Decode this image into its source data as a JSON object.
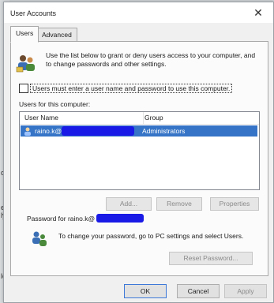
{
  "background": {
    "left_fragments": [
      "o",
      "e",
      "ly",
      "lc"
    ]
  },
  "window": {
    "title": "User Accounts",
    "close_glyph": "✕"
  },
  "tabs": [
    {
      "label": "Users",
      "active": true
    },
    {
      "label": "Advanced",
      "active": false
    }
  ],
  "users_tab": {
    "intro_text": "Use the list below to grant or deny users access to your computer, and to change passwords and other settings.",
    "require_login_checkbox": {
      "label": "Users must enter a user name and password to use this computer.",
      "checked": false
    },
    "users_list_title": "Users for this computer:",
    "columns": [
      "User Name",
      "Group"
    ],
    "rows": [
      {
        "user_name": "raino.k@",
        "group": "Administrators",
        "selected": true
      }
    ],
    "buttons": {
      "add": "Add...",
      "remove": "Remove",
      "properties": "Properties"
    },
    "password_section": {
      "label": "Password for raino.k@",
      "text": "To change your password, go to PC settings and select Users.",
      "reset_button": "Reset Password..."
    }
  },
  "dialog_buttons": {
    "ok": "OK",
    "cancel": "Cancel",
    "apply": "Apply"
  },
  "colors": {
    "selection": "#3574c6",
    "redaction": "#1a1ae6",
    "dialog_bg": "#f0f0f0"
  }
}
